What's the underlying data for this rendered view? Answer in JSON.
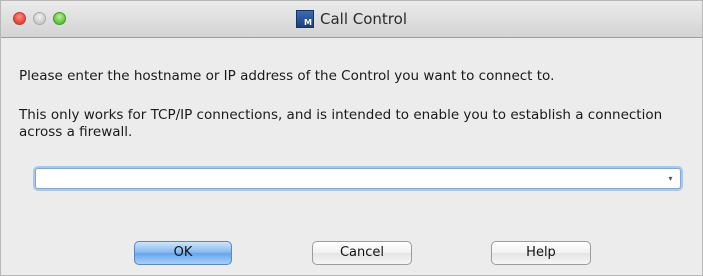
{
  "window": {
    "title": "Call Control",
    "app_icon_letter": "M",
    "icon": "app-icon"
  },
  "content": {
    "prompt": "Please enter the hostname or IP address of the Control you want to connect to.",
    "note": "This only works for TCP/IP connections, and is intended to enable you to establish a connection across a firewall."
  },
  "address": {
    "value": "",
    "arrow_glyph": "▾"
  },
  "buttons": {
    "ok": "OK",
    "cancel": "Cancel",
    "help": "Help"
  },
  "colors": {
    "default_button": "#65a6ec",
    "focus_ring": "#a9c8ee",
    "close": "#e0443a",
    "maximize": "#5fc238"
  }
}
